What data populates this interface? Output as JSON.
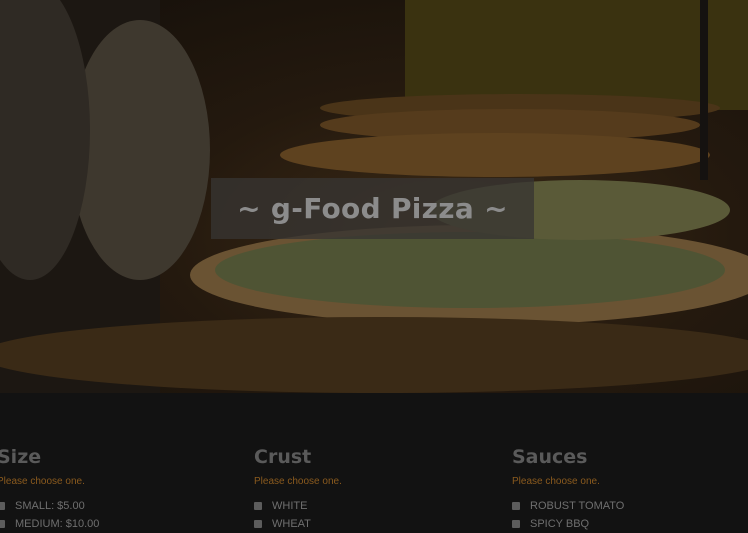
{
  "hero": {
    "title": "~ g-Food Pizza ~"
  },
  "columns": [
    {
      "title": "Size",
      "hint": "Please choose one.",
      "options": [
        "SMALL: $5.00",
        "MEDIUM: $10.00"
      ]
    },
    {
      "title": "Crust",
      "hint": "Please choose one.",
      "options": [
        "WHITE",
        "WHEAT"
      ]
    },
    {
      "title": "Sauces",
      "hint": "Please choose one.",
      "options": [
        "ROBUST TOMATO",
        "SPICY BBQ"
      ]
    }
  ],
  "colors": {
    "background": "#121212",
    "hint": "#8a5a1e",
    "heading": "#5a5a5a"
  }
}
